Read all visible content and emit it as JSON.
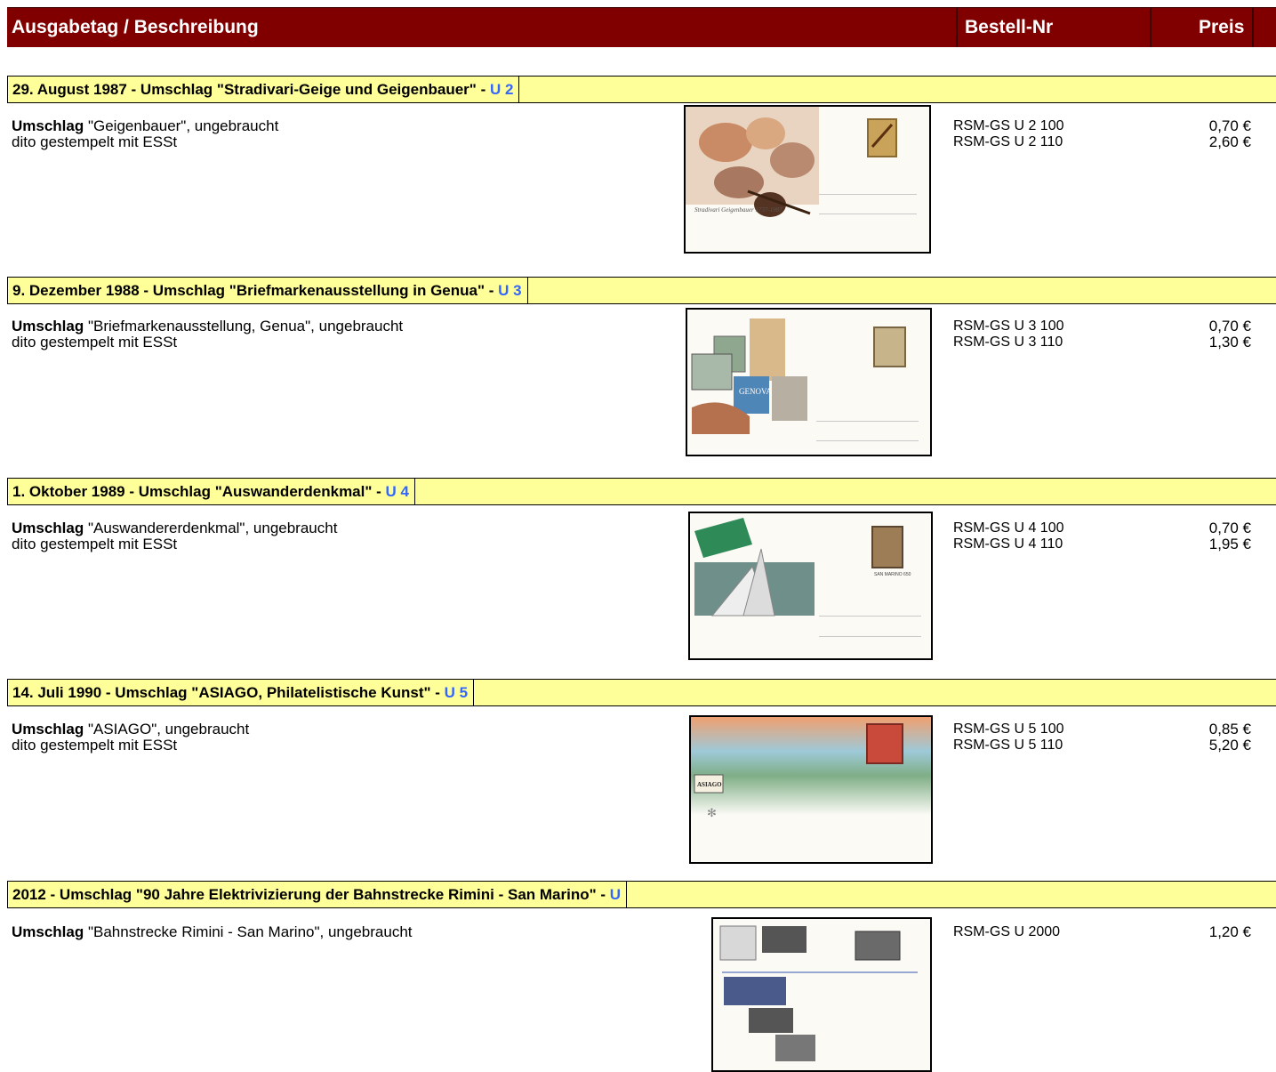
{
  "header": {
    "col_description": "Ausgabetag / Beschreibung",
    "col_order_no": "Bestell-Nr",
    "col_price": "Preis"
  },
  "sections": [
    {
      "title": "29. August 1987  - Umschlag \"Stradivari-Geige und Geigenbauer\" - ",
      "code": "U 2",
      "items": [
        {
          "bold": "Umschlag",
          "text": " \"Geigenbauer\", ungebraucht",
          "order_no": "RSM-GS U 2 100",
          "price": "0,70 €"
        },
        {
          "bold": "",
          "text": "dito gestempelt mit ESSt",
          "order_no": "RSM-GS U 2 110",
          "price": "2,60 €"
        }
      ],
      "image_caption": "Stradivari Geigenbauer 1737-1987"
    },
    {
      "title": "9. Dezember 1988  - Umschlag \"Briefmarkenausstellung in Genua\" - ",
      "code": "U 3",
      "items": [
        {
          "bold": "Umschlag",
          "text": " \"Briefmarkenausstellung, Genua\", ungebraucht",
          "order_no": "RSM-GS U 3 100",
          "price": "0,70 €"
        },
        {
          "bold": "",
          "text": "dito gestempelt mit ESSt",
          "order_no": "RSM-GS U 3 110",
          "price": "1,30 €"
        }
      ],
      "image_caption": "GENOVA 88"
    },
    {
      "title": "1. Oktober 1989  - Umschlag \"Auswanderdenkmal\" - ",
      "code": "U 4",
      "items": [
        {
          "bold": "Umschlag",
          "text": " \"Auswandererdenkmal\", ungebraucht",
          "order_no": "RSM-GS U 4 100",
          "price": "0,70 €"
        },
        {
          "bold": "",
          "text": "dito gestempelt mit ESSt",
          "order_no": "RSM-GS U 4 110",
          "price": "1,95 €"
        }
      ],
      "image_caption": "SAN MARINO 650"
    },
    {
      "title": "14. Juli 1990  - Umschlag \"ASIAGO, Philatelistische Kunst\" - ",
      "code": "U 5",
      "items": [
        {
          "bold": "Umschlag",
          "text": " \"ASIAGO\", ungebraucht",
          "order_no": "RSM-GS U 5 100",
          "price": "0,85 €"
        },
        {
          "bold": "",
          "text": "dito gestempelt mit ESSt",
          "order_no": "RSM-GS U 5 110",
          "price": "5,20 €"
        }
      ],
      "image_caption": "ASIAGO"
    },
    {
      "title": "2012  - Umschlag \"90 Jahre Elektrivizierung der Bahnstrecke Rimini - San Marino\" - ",
      "code": "U",
      "items": [
        {
          "bold": "Umschlag",
          "text": " \"Bahnstrecke Rimini - San Marino\", ungebraucht",
          "order_no": "RSM-GS U 2000",
          "price": "1,20 €"
        }
      ],
      "image_caption": ""
    }
  ]
}
